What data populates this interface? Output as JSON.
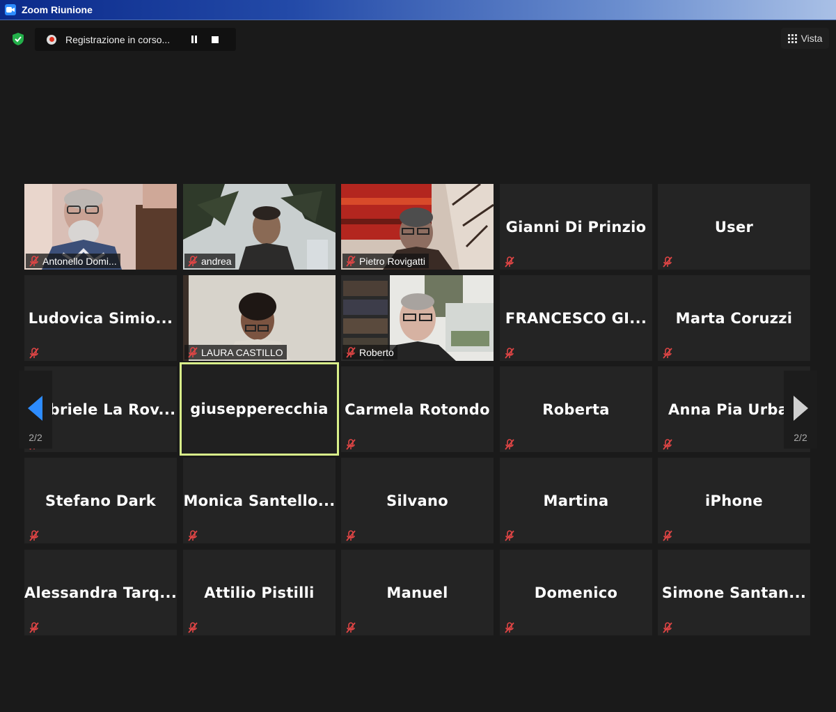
{
  "window": {
    "title": "Zoom Riunione"
  },
  "recording": {
    "status": "Registrazione in corso..."
  },
  "view_button": {
    "label": "Vista"
  },
  "pagination": {
    "prev_label": "2/2",
    "next_label": "2/2"
  },
  "video_participants": [
    {
      "name": "Antonello Domi..."
    },
    {
      "name": "andrea"
    },
    {
      "name": "Pietro Rovigatti"
    },
    {
      "name": "LAURA CASTILLO"
    },
    {
      "name": "Roberto"
    }
  ],
  "participants": [
    {
      "name": "Gianni Di Prinzio"
    },
    {
      "name": "User"
    },
    {
      "name": "Ludovica  Simio..."
    },
    {
      "name": "FRANCESCO  GI..."
    },
    {
      "name": "Marta Coruzzi"
    },
    {
      "name": "briele  La  Rov..."
    },
    {
      "name": "giusepperecchia"
    },
    {
      "name": "Carmela Rotondo"
    },
    {
      "name": "Roberta"
    },
    {
      "name": "Anna Pia Urbar"
    },
    {
      "name": "Stefano Dark"
    },
    {
      "name": "Monica  Santello..."
    },
    {
      "name": "Silvano"
    },
    {
      "name": "Martina"
    },
    {
      "name": "iPhone"
    },
    {
      "name": "Alessandra  Tarq..."
    },
    {
      "name": "Attilio Pistilli"
    },
    {
      "name": "Manuel"
    },
    {
      "name": "Domenico"
    },
    {
      "name": "Simone  Santan..."
    }
  ]
}
